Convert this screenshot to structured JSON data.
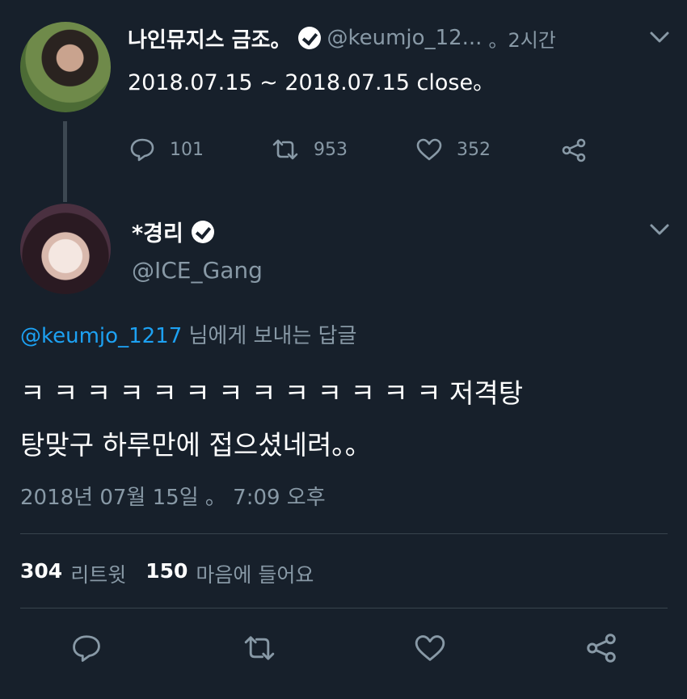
{
  "parent_tweet": {
    "display_name": "나인뮤지스 금조。",
    "handle": "@keumjo_12...",
    "time": "。2시간",
    "text": "2018.07.15 ~ 2018.07.15 close。",
    "reply_count": "101",
    "retweet_count": "953",
    "like_count": "352"
  },
  "reply_tweet": {
    "display_name": "*경리",
    "handle": "@ICE_Gang",
    "reply_to_handle": "@keumjo_1217",
    "reply_to_suffix": "님에게 보내는 답글",
    "text_line1": "ㅋ ㅋ ㅋ ㅋ ㅋ ㅋ ㅋ ㅋ ㅋ ㅋ ㅋ ㅋ ㅋ 저격탕",
    "text_line2": "탕맞구 하루만에 접으셨네려。。",
    "timestamp": "2018년 07월 15일 。 7:09 오후",
    "retweet_count": "304",
    "retweet_label": "리트윗",
    "like_count": "150",
    "like_label": "마음에 들어요"
  },
  "icons": {
    "reply": "reply-icon",
    "retweet": "retweet-icon",
    "like": "heart-icon",
    "share": "share-icon",
    "more": "chevron-down-icon",
    "verified": "verified-badge-icon"
  },
  "colors": {
    "background": "#17202b",
    "muted": "#8899a6",
    "link": "#1da1f2",
    "divider": "#38444d"
  }
}
